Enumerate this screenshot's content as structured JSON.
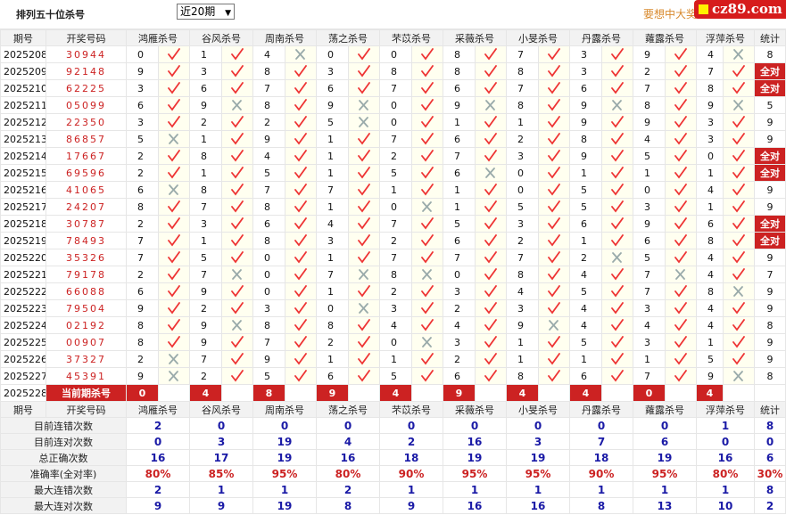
{
  "header": {
    "title": "排列五十位杀号",
    "period_select": "近20期",
    "notice": "要想中大奖",
    "logo_text": "cz89.com"
  },
  "columns": [
    "期号",
    "开奖号码",
    "鸿雁杀号",
    "谷风杀号",
    "周南杀号",
    "荡之杀号",
    "芣苡杀号",
    "采薇杀号",
    "小旻杀号",
    "丹露杀号",
    "蕹露杀号",
    "浮萍杀号",
    "统计"
  ],
  "rows": [
    {
      "issue": "2025208",
      "draw": "30944",
      "kills": [
        [
          0,
          1
        ],
        [
          1,
          1
        ],
        [
          4,
          0
        ],
        [
          0,
          1
        ],
        [
          0,
          1
        ],
        [
          8,
          1
        ],
        [
          7,
          1
        ],
        [
          3,
          1
        ],
        [
          9,
          1
        ],
        [
          4,
          0
        ]
      ],
      "count": "8"
    },
    {
      "issue": "2025209",
      "draw": "92148",
      "kills": [
        [
          9,
          1
        ],
        [
          3,
          1
        ],
        [
          8,
          1
        ],
        [
          3,
          1
        ],
        [
          8,
          1
        ],
        [
          8,
          1
        ],
        [
          8,
          1
        ],
        [
          3,
          1
        ],
        [
          2,
          1
        ],
        [
          7,
          1
        ]
      ],
      "count": "全对"
    },
    {
      "issue": "2025210",
      "draw": "62225",
      "kills": [
        [
          3,
          1
        ],
        [
          6,
          1
        ],
        [
          7,
          1
        ],
        [
          6,
          1
        ],
        [
          7,
          1
        ],
        [
          6,
          1
        ],
        [
          7,
          1
        ],
        [
          6,
          1
        ],
        [
          7,
          1
        ],
        [
          8,
          1
        ]
      ],
      "count": "全对"
    },
    {
      "issue": "2025211",
      "draw": "05099",
      "kills": [
        [
          6,
          1
        ],
        [
          9,
          0
        ],
        [
          8,
          1
        ],
        [
          9,
          0
        ],
        [
          0,
          1
        ],
        [
          9,
          0
        ],
        [
          8,
          1
        ],
        [
          9,
          0
        ],
        [
          8,
          1
        ],
        [
          9,
          0
        ]
      ],
      "count": "5"
    },
    {
      "issue": "2025212",
      "draw": "22350",
      "kills": [
        [
          3,
          1
        ],
        [
          2,
          1
        ],
        [
          2,
          1
        ],
        [
          5,
          0
        ],
        [
          0,
          1
        ],
        [
          1,
          1
        ],
        [
          1,
          1
        ],
        [
          9,
          1
        ],
        [
          9,
          1
        ],
        [
          3,
          1
        ]
      ],
      "count": "9"
    },
    {
      "issue": "2025213",
      "draw": "86857",
      "kills": [
        [
          5,
          0
        ],
        [
          1,
          1
        ],
        [
          9,
          1
        ],
        [
          1,
          1
        ],
        [
          7,
          1
        ],
        [
          6,
          1
        ],
        [
          2,
          1
        ],
        [
          8,
          1
        ],
        [
          4,
          1
        ],
        [
          3,
          1
        ]
      ],
      "count": "9"
    },
    {
      "issue": "2025214",
      "draw": "17667",
      "kills": [
        [
          2,
          1
        ],
        [
          8,
          1
        ],
        [
          4,
          1
        ],
        [
          1,
          1
        ],
        [
          2,
          1
        ],
        [
          7,
          1
        ],
        [
          3,
          1
        ],
        [
          9,
          1
        ],
        [
          5,
          1
        ],
        [
          0,
          1
        ]
      ],
      "count": "全对"
    },
    {
      "issue": "2025215",
      "draw": "69596",
      "kills": [
        [
          2,
          1
        ],
        [
          1,
          1
        ],
        [
          5,
          1
        ],
        [
          1,
          1
        ],
        [
          5,
          1
        ],
        [
          6,
          0
        ],
        [
          0,
          1
        ],
        [
          1,
          1
        ],
        [
          1,
          1
        ],
        [
          1,
          1
        ]
      ],
      "count": "全对"
    },
    {
      "issue": "2025216",
      "draw": "41065",
      "kills": [
        [
          6,
          0
        ],
        [
          8,
          1
        ],
        [
          7,
          1
        ],
        [
          7,
          1
        ],
        [
          1,
          1
        ],
        [
          1,
          1
        ],
        [
          0,
          1
        ],
        [
          5,
          1
        ],
        [
          0,
          1
        ],
        [
          4,
          1
        ]
      ],
      "count": "9"
    },
    {
      "issue": "2025217",
      "draw": "24207",
      "kills": [
        [
          8,
          1
        ],
        [
          7,
          1
        ],
        [
          8,
          1
        ],
        [
          1,
          1
        ],
        [
          0,
          0
        ],
        [
          1,
          1
        ],
        [
          5,
          1
        ],
        [
          5,
          1
        ],
        [
          3,
          1
        ],
        [
          1,
          1
        ]
      ],
      "count": "9"
    },
    {
      "issue": "2025218",
      "draw": "30787",
      "kills": [
        [
          2,
          1
        ],
        [
          3,
          1
        ],
        [
          6,
          1
        ],
        [
          4,
          1
        ],
        [
          7,
          1
        ],
        [
          5,
          1
        ],
        [
          3,
          1
        ],
        [
          6,
          1
        ],
        [
          9,
          1
        ],
        [
          6,
          1
        ]
      ],
      "count": "全对"
    },
    {
      "issue": "2025219",
      "draw": "78493",
      "kills": [
        [
          7,
          1
        ],
        [
          1,
          1
        ],
        [
          8,
          1
        ],
        [
          3,
          1
        ],
        [
          2,
          1
        ],
        [
          6,
          1
        ],
        [
          2,
          1
        ],
        [
          1,
          1
        ],
        [
          6,
          1
        ],
        [
          8,
          1
        ]
      ],
      "count": "全对"
    },
    {
      "issue": "2025220",
      "draw": "35326",
      "kills": [
        [
          7,
          1
        ],
        [
          5,
          1
        ],
        [
          0,
          1
        ],
        [
          1,
          1
        ],
        [
          7,
          1
        ],
        [
          7,
          1
        ],
        [
          7,
          1
        ],
        [
          2,
          0
        ],
        [
          5,
          1
        ],
        [
          4,
          1
        ]
      ],
      "count": "9"
    },
    {
      "issue": "2025221",
      "draw": "79178",
      "kills": [
        [
          2,
          1
        ],
        [
          7,
          0
        ],
        [
          0,
          1
        ],
        [
          7,
          0
        ],
        [
          8,
          0
        ],
        [
          0,
          1
        ],
        [
          8,
          1
        ],
        [
          4,
          1
        ],
        [
          7,
          0
        ],
        [
          4,
          1
        ]
      ],
      "count": "7"
    },
    {
      "issue": "2025222",
      "draw": "66088",
      "kills": [
        [
          6,
          1
        ],
        [
          9,
          1
        ],
        [
          0,
          1
        ],
        [
          1,
          1
        ],
        [
          2,
          1
        ],
        [
          3,
          1
        ],
        [
          4,
          1
        ],
        [
          5,
          1
        ],
        [
          7,
          1
        ],
        [
          8,
          0
        ]
      ],
      "count": "9"
    },
    {
      "issue": "2025223",
      "draw": "79504",
      "kills": [
        [
          9,
          1
        ],
        [
          2,
          1
        ],
        [
          3,
          1
        ],
        [
          0,
          0
        ],
        [
          3,
          1
        ],
        [
          2,
          1
        ],
        [
          3,
          1
        ],
        [
          4,
          1
        ],
        [
          3,
          1
        ],
        [
          4,
          1
        ]
      ],
      "count": "9"
    },
    {
      "issue": "2025224",
      "draw": "02192",
      "kills": [
        [
          8,
          1
        ],
        [
          9,
          0
        ],
        [
          8,
          1
        ],
        [
          8,
          1
        ],
        [
          4,
          1
        ],
        [
          4,
          1
        ],
        [
          9,
          0
        ],
        [
          4,
          1
        ],
        [
          4,
          1
        ],
        [
          4,
          1
        ]
      ],
      "count": "8"
    },
    {
      "issue": "2025225",
      "draw": "00907",
      "kills": [
        [
          8,
          1
        ],
        [
          9,
          1
        ],
        [
          7,
          1
        ],
        [
          2,
          1
        ],
        [
          0,
          0
        ],
        [
          3,
          1
        ],
        [
          1,
          1
        ],
        [
          5,
          1
        ],
        [
          3,
          1
        ],
        [
          1,
          1
        ]
      ],
      "count": "9"
    },
    {
      "issue": "2025226",
      "draw": "37327",
      "kills": [
        [
          2,
          0
        ],
        [
          7,
          1
        ],
        [
          9,
          1
        ],
        [
          1,
          1
        ],
        [
          1,
          1
        ],
        [
          2,
          1
        ],
        [
          1,
          1
        ],
        [
          1,
          1
        ],
        [
          1,
          1
        ],
        [
          5,
          1
        ]
      ],
      "count": "9"
    },
    {
      "issue": "2025227",
      "draw": "45391",
      "kills": [
        [
          9,
          0
        ],
        [
          2,
          1
        ],
        [
          5,
          1
        ],
        [
          6,
          1
        ],
        [
          5,
          1
        ],
        [
          6,
          1
        ],
        [
          8,
          1
        ],
        [
          6,
          1
        ],
        [
          7,
          1
        ],
        [
          9,
          0
        ]
      ],
      "count": "8"
    }
  ],
  "current": {
    "issue": "2025228",
    "label": "当前期杀号",
    "kills": [
      "0",
      "4",
      "8",
      "9",
      "4",
      "9",
      "4",
      "4",
      "0",
      "4"
    ]
  },
  "stats": [
    {
      "label": "目前连错次数",
      "values": [
        "2",
        "0",
        "0",
        "0",
        "0",
        "0",
        "0",
        "0",
        "0",
        "1"
      ],
      "total": "8",
      "pct": false
    },
    {
      "label": "目前连对次数",
      "values": [
        "0",
        "3",
        "19",
        "4",
        "2",
        "16",
        "3",
        "7",
        "6",
        "0"
      ],
      "total": "0",
      "pct": false
    },
    {
      "label": "总正确次数",
      "values": [
        "16",
        "17",
        "19",
        "16",
        "18",
        "19",
        "19",
        "18",
        "19",
        "16"
      ],
      "total": "6",
      "pct": false
    },
    {
      "label": "准确率(全对率)",
      "values": [
        "80%",
        "85%",
        "95%",
        "80%",
        "90%",
        "95%",
        "95%",
        "90%",
        "95%",
        "80%"
      ],
      "total": "30%",
      "pct": true
    },
    {
      "label": "最大连错次数",
      "values": [
        "2",
        "1",
        "1",
        "2",
        "1",
        "1",
        "1",
        "1",
        "1",
        "1"
      ],
      "total": "8",
      "pct": false
    },
    {
      "label": "最大连对次数",
      "values": [
        "9",
        "9",
        "19",
        "8",
        "9",
        "16",
        "16",
        "8",
        "13",
        "10"
      ],
      "total": "2",
      "pct": false
    }
  ],
  "colors": {
    "accent_red": "#cc2222",
    "stat_blue": "#1a1aa6",
    "header_bg": "#f2f2f2"
  }
}
